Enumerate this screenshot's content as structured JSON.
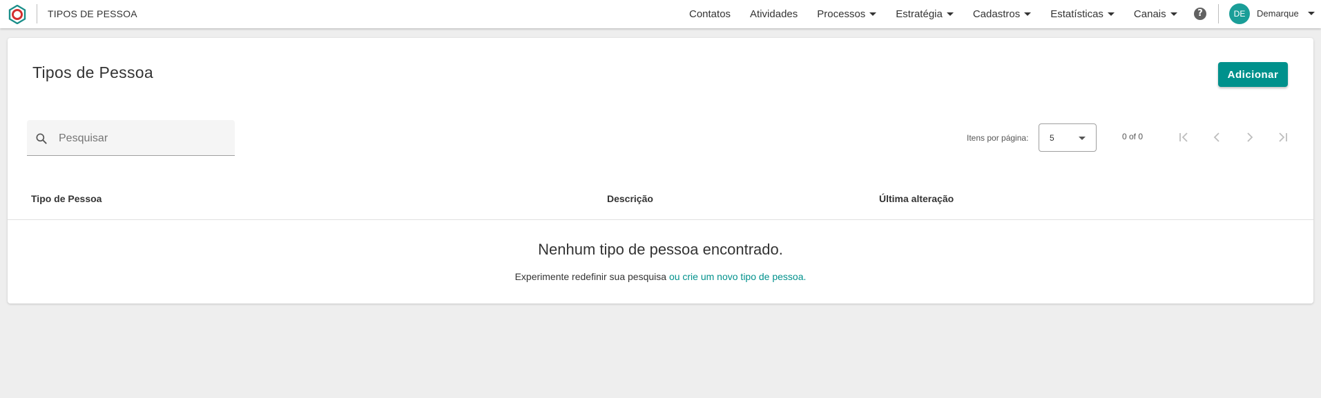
{
  "colors": {
    "accent": "#00918c",
    "avatar_bg": "#1a9e98",
    "logo_red": "#d32f2f",
    "logo_teal": "#1b8f8a"
  },
  "header": {
    "app_title": "TIPOS DE PESSOA",
    "nav": [
      {
        "label": "Contatos",
        "has_dropdown": false
      },
      {
        "label": "Atividades",
        "has_dropdown": false
      },
      {
        "label": "Processos",
        "has_dropdown": true
      },
      {
        "label": "Estratégia",
        "has_dropdown": true
      },
      {
        "label": "Cadastros",
        "has_dropdown": true
      },
      {
        "label": "Estatísticas",
        "has_dropdown": true
      },
      {
        "label": "Canais",
        "has_dropdown": true
      }
    ],
    "help_icon": "?",
    "user": {
      "initials": "DE",
      "name": "Demarque"
    }
  },
  "main": {
    "title": "Tipos de Pessoa",
    "add_button_label": "Adicionar",
    "search": {
      "placeholder": "Pesquisar",
      "value": ""
    },
    "pagination": {
      "items_per_page_label": "Itens por página:",
      "items_per_page_value": "5",
      "range_label": "0 of 0",
      "icons": [
        "first-page-icon",
        "previous-page-icon",
        "next-page-icon",
        "last-page-icon"
      ]
    },
    "table": {
      "columns": [
        "Tipo de Pessoa",
        "Descrição",
        "Última alteração"
      ],
      "rows": []
    },
    "empty_state": {
      "title": "Nenhum tipo de pessoa encontrado.",
      "hint_text": "Experimente redefinir sua pesquisa",
      "hint_link": "ou crie um novo tipo de pessoa."
    }
  }
}
